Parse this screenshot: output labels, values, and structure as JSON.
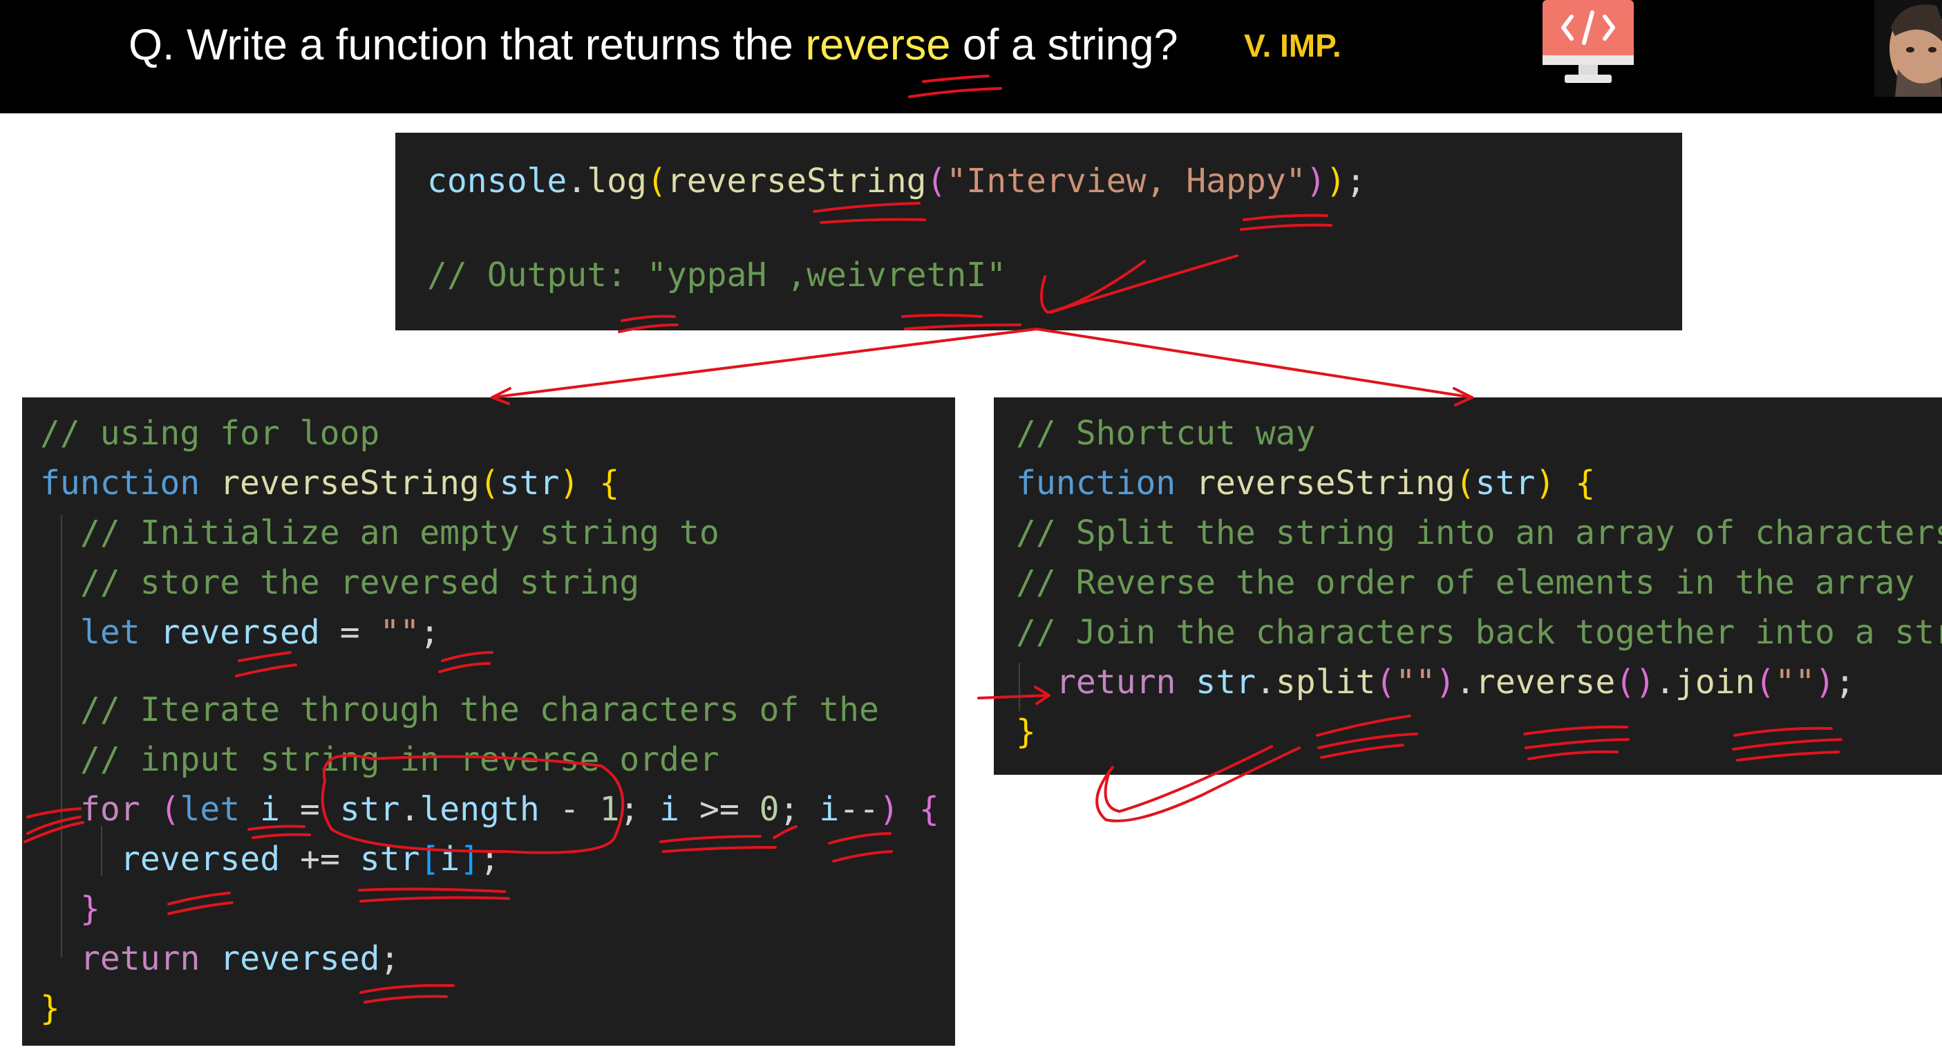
{
  "header": {
    "question_prefix": "Q. Write a function that returns the ",
    "question_keyword": "reverse",
    "question_suffix": " of a string?",
    "importance_badge": "V. IMP.",
    "code_icon": "monitor-code-icon",
    "avatar_icon": "presenter-avatar"
  },
  "top_code": {
    "line1": {
      "t1": "console",
      "t2": ".",
      "t3": "log",
      "t4": "(",
      "t5": "reverseString",
      "t6": "(",
      "t7": "\"Interview, Happy\"",
      "t8": ")",
      "t9": ")",
      "t10": ";"
    },
    "line2": "// Output: \"yppaH ,weivretnI\""
  },
  "left_code": {
    "l1": "// using for loop",
    "l2": {
      "t1": "function",
      "t2": " ",
      "t3": "reverseString",
      "t4": "(",
      "t5": "str",
      "t6": ")",
      "t7": " ",
      "t8": "{"
    },
    "l3": "// Initialize an empty string to",
    "l4": "// store the reversed string",
    "l5": {
      "t1": "let",
      "t2": " ",
      "t3": "reversed",
      "t4": " = ",
      "t5": "\"\"",
      "t6": ";"
    },
    "l6": "// Iterate through the characters of the",
    "l7": "// input string in reverse order",
    "l8": {
      "t1": "for",
      "t2": " ",
      "t3": "(",
      "t4": "let",
      "t5": " ",
      "t6": "i",
      "t7": " = ",
      "t8": "str",
      "t9": ".",
      "t10": "length",
      "t11": " - ",
      "t12": "1",
      "t13": "; ",
      "t14": "i",
      "t15": " >= ",
      "t16": "0",
      "t17": "; ",
      "t18": "i",
      "t19": "--",
      "t20": ")",
      "t21": " ",
      "t22": "{"
    },
    "l9": {
      "t1": "reversed",
      "t2": " += ",
      "t3": "str",
      "t4": "[",
      "t5": "i",
      "t6": "]",
      "t7": ";"
    },
    "l10": "}",
    "l11": {
      "t1": "return",
      "t2": " ",
      "t3": "reversed",
      "t4": ";"
    },
    "l12": "}"
  },
  "right_code": {
    "l1": "// Shortcut way",
    "l2": {
      "t1": "function",
      "t2": " ",
      "t3": "reverseString",
      "t4": "(",
      "t5": "str",
      "t6": ")",
      "t7": " ",
      "t8": "{"
    },
    "l3": "// Split the string into an array of characters",
    "l4": "// Reverse the order of elements in the array",
    "l5": "// Join the characters back together into a string",
    "l6": {
      "t1": "return",
      "t2": " ",
      "t3": "str",
      "t4": ".",
      "t5": "split",
      "t6": "(",
      "t7": "\"\"",
      "t8": ")",
      "t9": ".",
      "t10": "reverse",
      "t11": "()",
      "t12": ".",
      "t13": "join",
      "t14": "(",
      "t15": "\"\"",
      "t16": ")",
      "t17": ";"
    },
    "l7": "}"
  },
  "colors": {
    "annotation_red": "#e0141e",
    "header_keyword": "#ffe94d",
    "badge": "#f5c518",
    "code_bg": "#1e1e1e",
    "icon_salmon": "#f0776a"
  }
}
